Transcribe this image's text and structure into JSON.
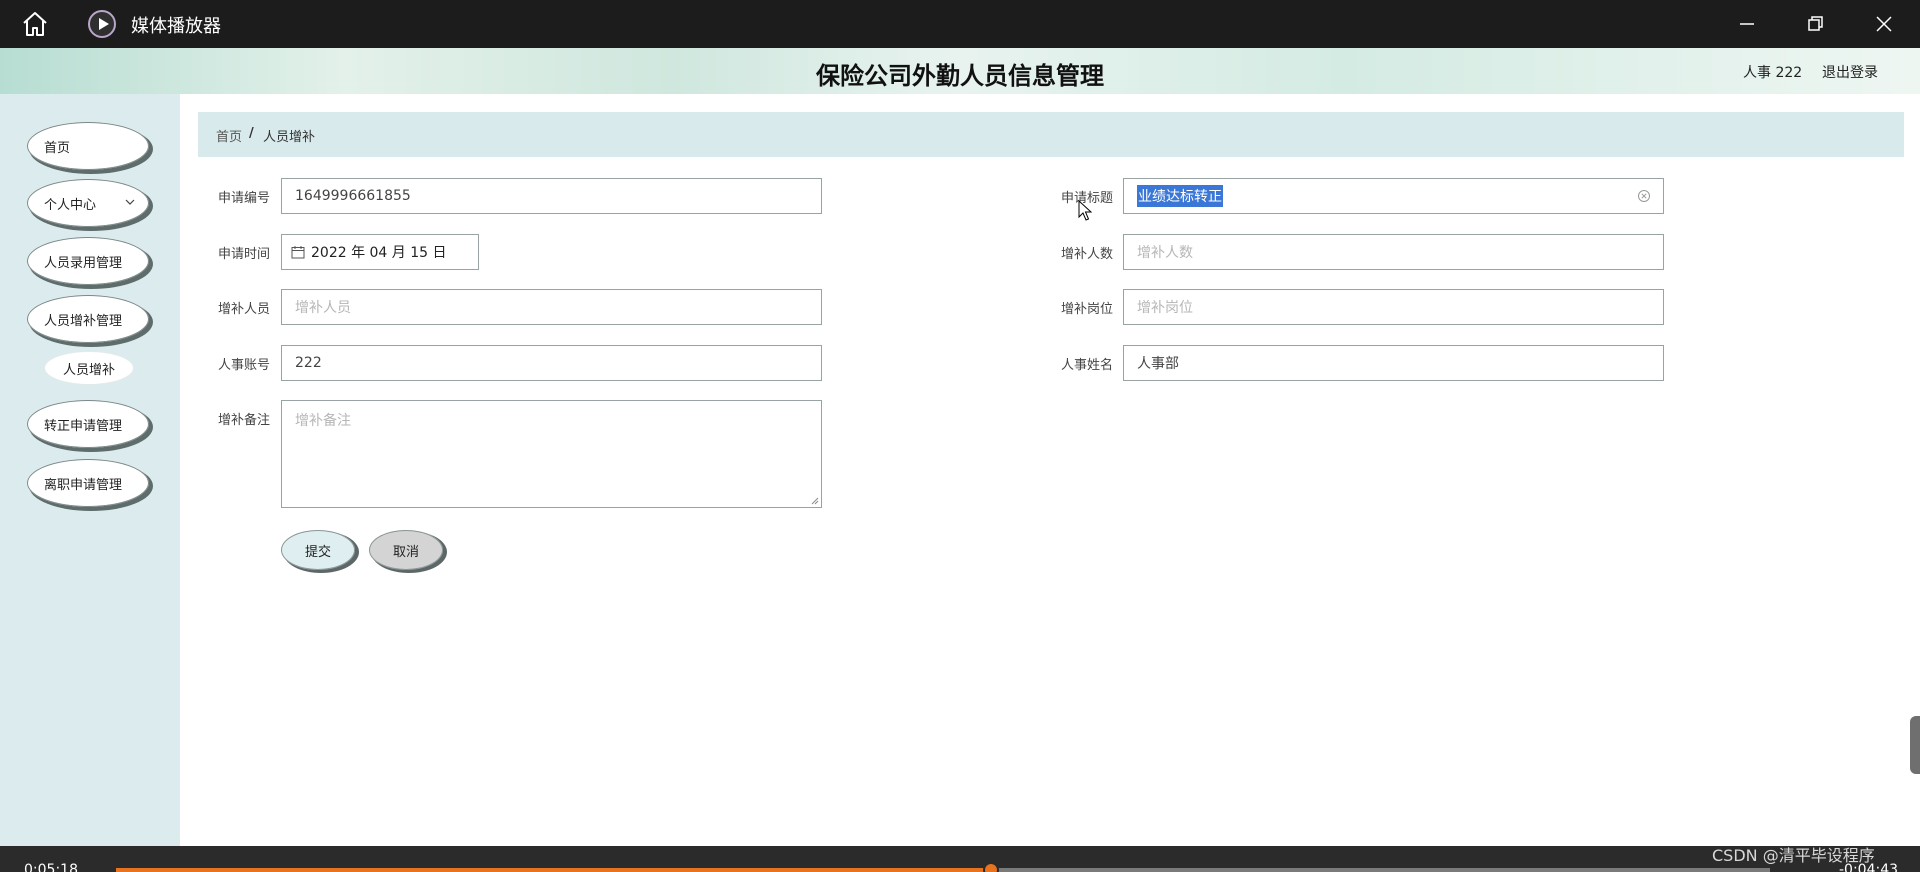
{
  "player": {
    "title": "媒体播放器",
    "time_elapsed": "0:05:18",
    "time_remaining": "-0:04:43",
    "progress_fraction": 0.529
  },
  "header": {
    "title": "保险公司外勤人员信息管理",
    "user": "人事 222",
    "logout": "退出登录"
  },
  "sidebar": {
    "items": [
      {
        "label": "首页"
      },
      {
        "label": "个人中心"
      },
      {
        "label": "人员录用管理"
      },
      {
        "label": "人员增补管理"
      },
      {
        "label": "人员增补"
      },
      {
        "label": "转正申请管理"
      },
      {
        "label": "离职申请管理"
      }
    ]
  },
  "breadcrumb": {
    "home": "首页",
    "separator": "/",
    "current": "人员增补"
  },
  "form": {
    "application_no": {
      "label": "申请编号",
      "value": "1649996661855"
    },
    "application_title": {
      "label": "申请标题",
      "value": "业绩达标转正"
    },
    "application_time": {
      "label": "申请时间",
      "value": "2022 年 04 月 15 日"
    },
    "headcount": {
      "label": "增补人数",
      "placeholder": "增补人数"
    },
    "staff": {
      "label": "增补人员",
      "placeholder": "增补人员"
    },
    "position": {
      "label": "增补岗位",
      "placeholder": "增补岗位"
    },
    "hr_account": {
      "label": "人事账号",
      "value": "222"
    },
    "hr_name": {
      "label": "人事姓名",
      "value": "人事部"
    },
    "remarks": {
      "label": "增补备注",
      "placeholder": "增补备注"
    },
    "submit_label": "提交",
    "cancel_label": "取消"
  },
  "watermark": "CSDN @清平毕设程序",
  "colors": {
    "sidebar_bg": "#dcebee",
    "progress": "#e8731f",
    "selection": "#3a77d6"
  }
}
